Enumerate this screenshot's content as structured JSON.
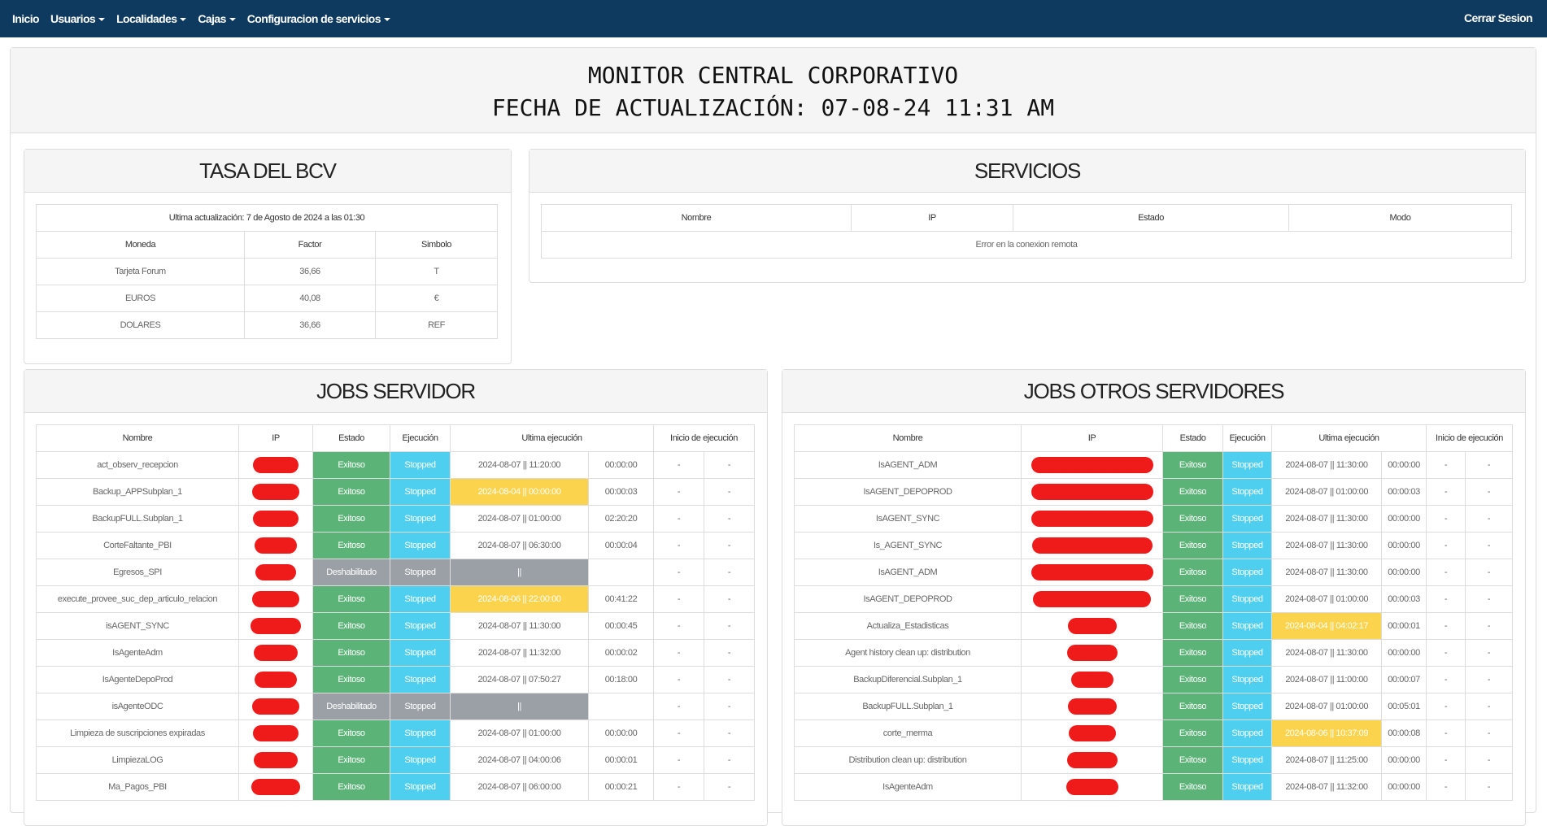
{
  "nav": {
    "items": [
      {
        "label": "Inicio",
        "dropdown": false
      },
      {
        "label": "Usuarios",
        "dropdown": true
      },
      {
        "label": "Localidades",
        "dropdown": true
      },
      {
        "label": "Cajas",
        "dropdown": true
      },
      {
        "label": "Configuracion de servicios",
        "dropdown": true
      }
    ],
    "logout": "Cerrar Sesion"
  },
  "header": {
    "title": "MONITOR CENTRAL CORPORATIVO",
    "updated": "FECHA DE ACTUALIZACIÓN: 07-08-24 11:31 AM"
  },
  "bcv": {
    "title": "TASA DEL BCV",
    "last_update": "Ultima actualización: 7 de Agosto de 2024 a las 01:30",
    "columns": [
      "Moneda",
      "Factor",
      "Simbolo"
    ],
    "rows": [
      [
        "Tarjeta Forum",
        "36,66",
        "T"
      ],
      [
        "EUROS",
        "40,08",
        "€"
      ],
      [
        "DOLARES",
        "36,66",
        "REF"
      ]
    ]
  },
  "servicios": {
    "title": "SERVICIOS",
    "columns": [
      "Nombre",
      "IP",
      "Estado",
      "Modo"
    ],
    "message": "Error en la conexion remota"
  },
  "jobs_servidor": {
    "title": "JOBS SERVIDOR",
    "columns": [
      "Nombre",
      "IP",
      "Estado",
      "Ejecución",
      "Ultima ejecución",
      "Inicio de ejecución"
    ],
    "rows": [
      {
        "name": "act_observ_recepcion",
        "estado": "Exitoso",
        "ejec": "Stopped",
        "ultima": "2024-08-07 || 11:20:00",
        "dur": "00:00:00",
        "warn": false,
        "disabled": false
      },
      {
        "name": "Backup_APPSubplan_1",
        "estado": "Exitoso",
        "ejec": "Stopped",
        "ultima": "2024-08-04 || 00:00:00",
        "dur": "00:00:03",
        "warn": true,
        "disabled": false
      },
      {
        "name": "BackupFULL.Subplan_1",
        "estado": "Exitoso",
        "ejec": "Stopped",
        "ultima": "2024-08-07 || 01:00:00",
        "dur": "02:20:20",
        "warn": false,
        "disabled": false
      },
      {
        "name": "CorteFaltante_PBI",
        "estado": "Exitoso",
        "ejec": "Stopped",
        "ultima": "2024-08-07 || 06:30:00",
        "dur": "00:00:04",
        "warn": false,
        "disabled": false
      },
      {
        "name": "Egresos_SPI",
        "estado": "Deshabilitado",
        "ejec": "Stopped",
        "ultima": "||",
        "dur": "",
        "warn": false,
        "disabled": true
      },
      {
        "name": "execute_provee_suc_dep_articulo_relacion",
        "estado": "Exitoso",
        "ejec": "Stopped",
        "ultima": "2024-08-06 || 22:00:00",
        "dur": "00:41:22",
        "warn": true,
        "disabled": false
      },
      {
        "name": "isAGENT_SYNC",
        "estado": "Exitoso",
        "ejec": "Stopped",
        "ultima": "2024-08-07 || 11:30:00",
        "dur": "00:00:45",
        "warn": false,
        "disabled": false
      },
      {
        "name": "IsAgenteAdm",
        "estado": "Exitoso",
        "ejec": "Stopped",
        "ultima": "2024-08-07 || 11:32:00",
        "dur": "00:00:02",
        "warn": false,
        "disabled": false
      },
      {
        "name": "IsAgenteDepoProd",
        "estado": "Exitoso",
        "ejec": "Stopped",
        "ultima": "2024-08-07 || 07:50:27",
        "dur": "00:18:00",
        "warn": false,
        "disabled": false
      },
      {
        "name": "isAgenteODC",
        "estado": "Deshabilitado",
        "ejec": "Stopped",
        "ultima": "||",
        "dur": "",
        "warn": false,
        "disabled": true
      },
      {
        "name": "Limpieza de suscripciones expiradas",
        "estado": "Exitoso",
        "ejec": "Stopped",
        "ultima": "2024-08-07 || 01:00:00",
        "dur": "00:00:00",
        "warn": false,
        "disabled": false
      },
      {
        "name": "LimpiezaLOG",
        "estado": "Exitoso",
        "ejec": "Stopped",
        "ultima": "2024-08-07 || 04:00:06",
        "dur": "00:00:01",
        "warn": false,
        "disabled": false
      },
      {
        "name": "Ma_Pagos_PBI",
        "estado": "Exitoso",
        "ejec": "Stopped",
        "ultima": "2024-08-07 || 06:00:00",
        "dur": "00:00:21",
        "warn": false,
        "disabled": false
      }
    ]
  },
  "jobs_otros": {
    "title": "JOBS OTROS SERVIDORES",
    "columns": [
      "Nombre",
      "IP",
      "Estado",
      "Ejecución",
      "Ultima ejecución",
      "Inicio de ejecución"
    ],
    "rows": [
      {
        "name": "IsAGENT_ADM",
        "estado": "Exitoso",
        "ejec": "Stopped",
        "ultima": "2024-08-07 || 11:30:00",
        "dur": "00:00:00",
        "warn": false
      },
      {
        "name": "IsAGENT_DEPOPROD",
        "estado": "Exitoso",
        "ejec": "Stopped",
        "ultima": "2024-08-07 || 01:00:00",
        "dur": "00:00:03",
        "warn": false
      },
      {
        "name": "IsAGENT_SYNC",
        "estado": "Exitoso",
        "ejec": "Stopped",
        "ultima": "2024-08-07 || 11:30:00",
        "dur": "00:00:00",
        "warn": false
      },
      {
        "name": "Is_AGENT_SYNC",
        "estado": "Exitoso",
        "ejec": "Stopped",
        "ultima": "2024-08-07 || 11:30:00",
        "dur": "00:00:00",
        "warn": false
      },
      {
        "name": "IsAGENT_ADM",
        "estado": "Exitoso",
        "ejec": "Stopped",
        "ultima": "2024-08-07 || 11:30:00",
        "dur": "00:00:00",
        "warn": false
      },
      {
        "name": "IsAGENT_DEPOPROD",
        "estado": "Exitoso",
        "ejec": "Stopped",
        "ultima": "2024-08-07 || 01:00:00",
        "dur": "00:00:03",
        "warn": false
      },
      {
        "name": "Actualiza_Estadisticas",
        "estado": "Exitoso",
        "ejec": "Stopped",
        "ultima": "2024-08-04 || 04:02:17",
        "dur": "00:00:01",
        "warn": true
      },
      {
        "name": "Agent history clean up: distribution",
        "estado": "Exitoso",
        "ejec": "Stopped",
        "ultima": "2024-08-07 || 11:30:00",
        "dur": "00:00:00",
        "warn": false
      },
      {
        "name": "BackupDiferencial.Subplan_1",
        "estado": "Exitoso",
        "ejec": "Stopped",
        "ultima": "2024-08-07 || 11:00:00",
        "dur": "00:00:07",
        "warn": false
      },
      {
        "name": "BackupFULL.Subplan_1",
        "estado": "Exitoso",
        "ejec": "Stopped",
        "ultima": "2024-08-07 || 01:00:00",
        "dur": "00:05:01",
        "warn": false
      },
      {
        "name": "corte_merma",
        "estado": "Exitoso",
        "ejec": "Stopped",
        "ultima": "2024-08-06 || 10:37:09",
        "dur": "00:00:08",
        "warn": true
      },
      {
        "name": "Distribution clean up: distribution",
        "estado": "Exitoso",
        "ejec": "Stopped",
        "ultima": "2024-08-07 || 11:25:00",
        "dur": "00:00:00",
        "warn": false
      },
      {
        "name": "IsAgenteAdm",
        "estado": "Exitoso",
        "ejec": "Stopped",
        "ultima": "2024-08-07 || 11:32:00",
        "dur": "00:00:00",
        "warn": false
      }
    ]
  },
  "dash": "-"
}
